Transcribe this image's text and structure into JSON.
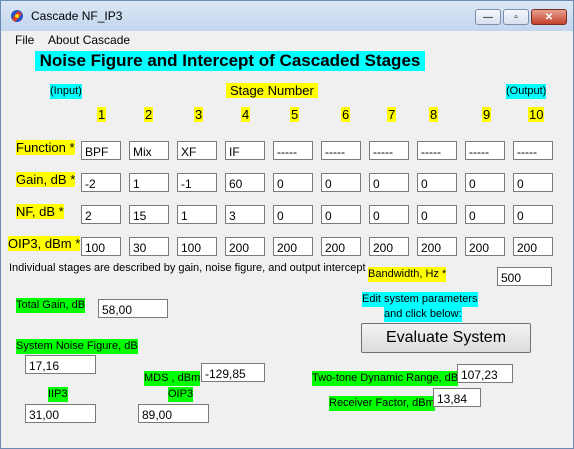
{
  "window": {
    "title": "Cascade NF_IP3",
    "minimize_label": "—",
    "maximize_label": "▫",
    "close_label": "✕"
  },
  "menu": [
    "File",
    "About Cascade"
  ],
  "heading": "Noise Figure and Intercept of Cascaded Stages",
  "input_label": "(Input)",
  "output_label": "(Output)",
  "stage_number_label": "Stage Number",
  "stage_numbers": [
    "1",
    "2",
    "3",
    "4",
    "5",
    "6",
    "7",
    "8",
    "9",
    "10"
  ],
  "row_labels": {
    "function": "Function *",
    "gain": "Gain, dB *",
    "nf": "NF, dB *",
    "oip3": "OIP3, dBm *"
  },
  "stages": {
    "function": [
      "BPF",
      "Mix",
      "XF",
      "IF",
      "-----",
      "-----",
      "-----",
      "-----",
      "-----",
      "-----"
    ],
    "gain": [
      "-2",
      "1",
      "-1",
      "60",
      "0",
      "0",
      "0",
      "0",
      "0",
      "0"
    ],
    "nf": [
      "2",
      "15",
      "1",
      "3",
      "0",
      "0",
      "0",
      "0",
      "0",
      "0"
    ],
    "oip3": [
      "100",
      "30",
      "100",
      "200",
      "200",
      "200",
      "200",
      "200",
      "200",
      "200"
    ]
  },
  "description": "Individual stages are described by gain, noise figure, and output intercept .",
  "bandwidth": {
    "label": "Bandwidth, Hz *",
    "value": "500"
  },
  "edit_hint": [
    "Edit system parameters",
    "and click below:"
  ],
  "evaluate_button": "Evaluate System",
  "results": {
    "total_gain": {
      "label": "Total Gain, dB",
      "value": "58,00"
    },
    "system_nf": {
      "label": "System Noise Figure, dB",
      "value": "17,16"
    },
    "mds": {
      "label": "MDS , dBm",
      "value": "-129,85"
    },
    "iip3": {
      "label": "IIP3",
      "value": "31,00"
    },
    "oip3": {
      "label": "OIP3",
      "value": "89,00"
    },
    "two_tone_dr": {
      "label": "Two-tone Dynamic Range, dB",
      "value": "107,23"
    },
    "receiver_factor": {
      "label": "Receiver Factor, dBm",
      "value": "13,84"
    }
  },
  "colors": {
    "yellow": "#ffff00",
    "cyan": "#00ffff",
    "green": "#00ff00"
  },
  "icons": {
    "app": "app-icon"
  }
}
